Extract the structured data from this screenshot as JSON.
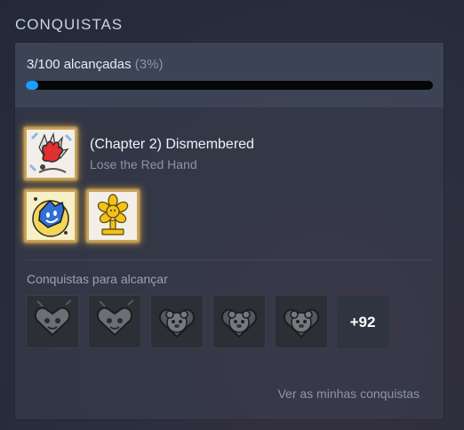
{
  "section_title": "CONQUISTAS",
  "progress": {
    "count_label": "3/100 alcançadas",
    "percent_label": "(3%)",
    "fraction": 0.03
  },
  "featured": {
    "title": "(Chapter 2) Dismembered",
    "description": "Lose the Red Hand",
    "icon": "red-hand-icon"
  },
  "unlocked_icons": [
    "blue-glove-icon",
    "golden-flower-trophy-icon"
  ],
  "locked": {
    "label": "Conquistas para alcançar",
    "icons": [
      "locked-heart-face-icon",
      "locked-heart-face-icon",
      "locked-bear-icon",
      "locked-bear-icon",
      "locked-bear-icon"
    ],
    "more_label": "+92"
  },
  "view_link": "Ver as minhas conquistas",
  "colors": {
    "accent": "#1a9fff",
    "gold_border": "#caa35a"
  }
}
